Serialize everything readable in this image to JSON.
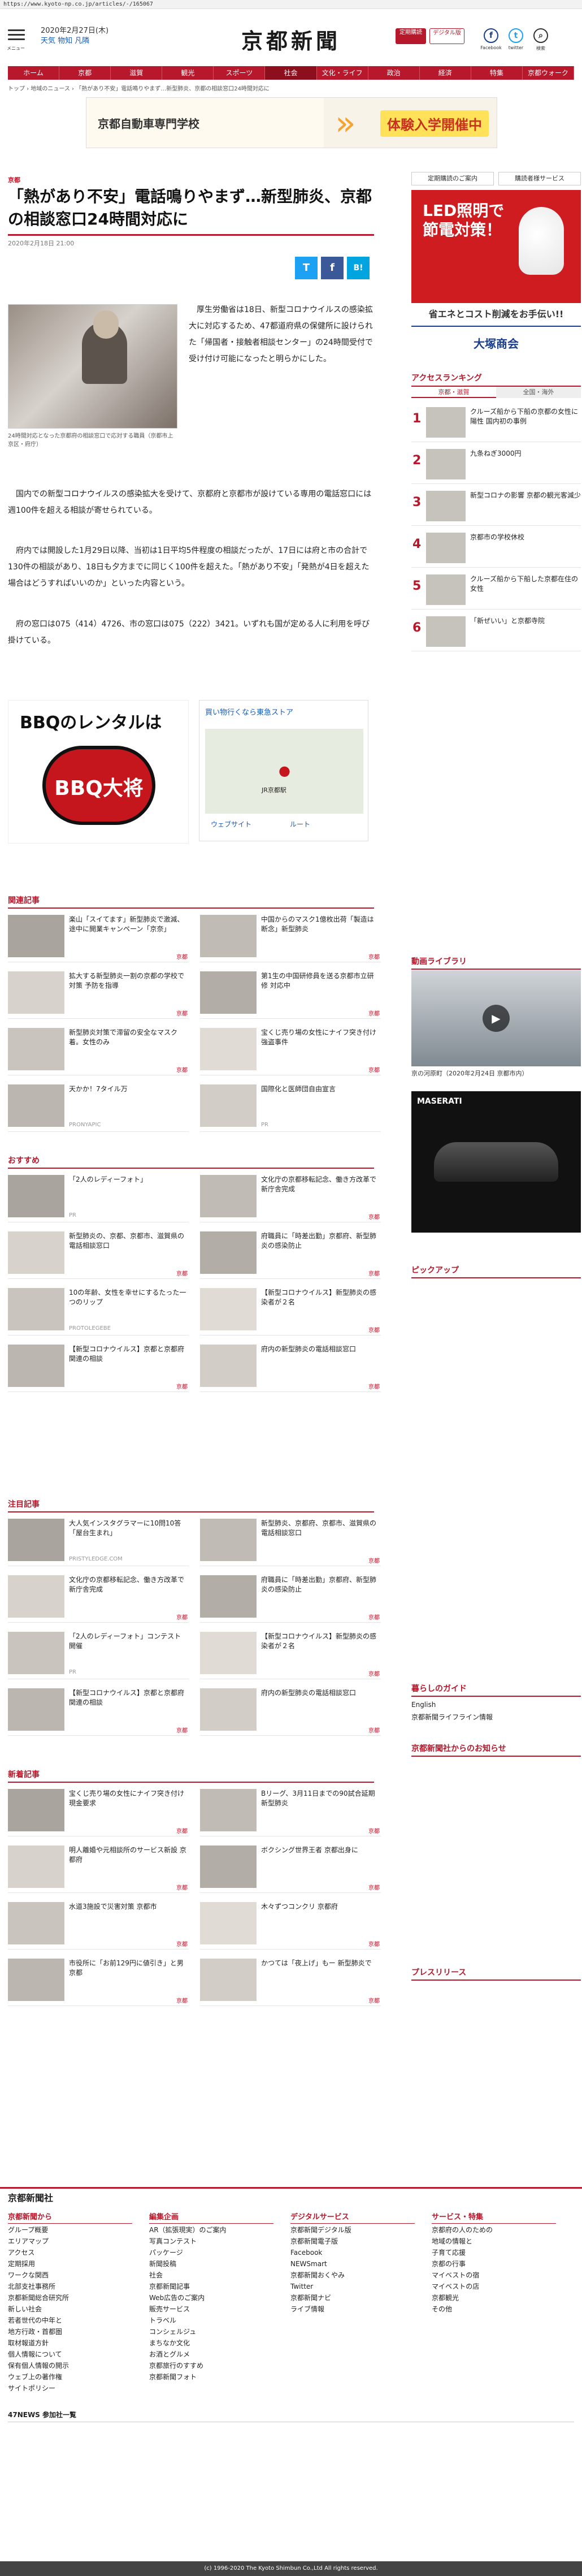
{
  "url": "https://www.kyoto-np.co.jp/articles/-/165067",
  "header": {
    "menu_label": "メニュー",
    "date": "2020年2月27日(木)",
    "weather": "天気 物知 凡隣",
    "logo": "京都新聞",
    "btn_subscribe": "定期購読",
    "btn_digital": "デジタル版",
    "icons": [
      "facebook-icon",
      "twitter-icon",
      "search-icon"
    ],
    "icon_labels": [
      "Facebook",
      "twitter",
      "検索"
    ]
  },
  "nav": [
    "ホーム",
    "京都",
    "滋賀",
    "観光",
    "スポーツ",
    "社会",
    "文化・ライフ",
    "政治",
    "経済",
    "特集",
    "京都ウォーク"
  ],
  "breadcrumb": "トップ › 地域のニュース › 「熱があり不安」電話鳴りやまず…新型肺炎、京都の相談窓口24時間対応に",
  "ad_top": {
    "left_text": "京都自動車専門学校",
    "right_text": "体験入学開催中"
  },
  "article": {
    "section": "京都",
    "headline": "「熱があり不安」電話鳴りやまず…新型肺炎、京都の相談窓口24時間対応に",
    "date": "2020年2月18日 21:00",
    "share": [
      "T",
      "f",
      "B!"
    ],
    "photo_caption": "24時間対応となった京都府の相談窓口で応対する職員（京都市上京区・府庁）",
    "paragraphs": [
      "厚生労働省は18日、新型コロナウイルスの感染拡大に対応するため、47都道府県の保健所に設けられた「帰国者・接触者相談センター」の24時間受付で受け付け可能になったと明らかにした。",
      "国内での新型コロナウイルスの感染拡大を受けて、京都府と京都市が設けている専用の電話窓口には週100件を超える相談が寄せられている。",
      "府内では開設した1月29日以降、当初は1日平均5件程度の相談だったが、17日には府と市の合計で130件の相談があり、18日も夕方までに同じく100件を超えた。「熱があり不安」「発熱が4日を超えた場合はどうすればいいのか」といった内容という。",
      "府の窓口は075（414）4726、市の窓口は075（222）3421。いずれも国が定める人に利用を呼び掛けている。"
    ]
  },
  "sidebar": {
    "links": [
      "定期購読のご案内",
      "購読者様サービス"
    ],
    "ad1": {
      "title": "LED照明で節電対策！",
      "mid": "省エネとコスト削減をお手伝い!!",
      "bot": "大塚商会"
    },
    "ranking_title": "アクセスランキング",
    "ranking_tabs": [
      "京都・滋賀",
      "全国・海外"
    ],
    "ranking": [
      {
        "num": "1",
        "text": "クルーズ船から下船の京都の女性に陽性 国内初の事例"
      },
      {
        "num": "2",
        "text": "九条ねぎ3000円"
      },
      {
        "num": "3",
        "text": "新型コロナの影響 京都の観光客減少"
      },
      {
        "num": "4",
        "text": "京都市の学校休校"
      },
      {
        "num": "5",
        "text": "クルーズ船から下船した京都在住の女性"
      },
      {
        "num": "6",
        "text": "「新ぜいい」と京都寺院"
      }
    ],
    "video_title": "動画ライブラリ",
    "video_caption": "京の河原町（2020年2月24日 京都市内）",
    "pickup_title": "ピックアップ",
    "guide_title": "暮らしのガイド",
    "guide_items": [
      "English",
      "京都新聞ライフライン情報"
    ],
    "notice_title": "京都新聞社からのお知らせ",
    "press_title": "プレスリリース"
  },
  "ad_bbq": {
    "title": "BBQのレンタルは",
    "logo": "BBQ大将"
  },
  "ad_map": {
    "title": "買い物行くなら東急ストア",
    "sub": "JR京都駅",
    "btns": [
      "ウェブサイト",
      "ルート"
    ]
  },
  "related": {
    "title": "関連記事",
    "items": [
      {
        "text": "楽山「スイてます」新型肺炎で激減、途中に開業キャンペーン「京奈」",
        "src": "京都"
      },
      {
        "text": "中国からのマスク1億枚出荷「製造は断念」新型肺炎",
        "src": "京都"
      },
      {
        "text": "拡大する新型肺炎一割の京都の学校で対策 予防を指導",
        "src": "京都"
      },
      {
        "text": "第1生の中国研修員を送る京都市立研修 対応中",
        "src": "京都"
      },
      {
        "text": "新型肺炎対策で滞留の安全なマスク着。女性のみ",
        "src": "京都"
      },
      {
        "text": "宝くじ売り場の女性にナイフ突き付け強盗事件",
        "src": "京都"
      },
      {
        "text": "天かか！7タイル万",
        "src": "PRONYAPIC"
      },
      {
        "text": "国際化と医師団自由宣言",
        "src": "PR"
      }
    ]
  },
  "recommend": {
    "title": "おすすめ",
    "items": [
      {
        "text": "「2人のレディーフォト」",
        "src": "PR"
      },
      {
        "text": "文化庁の京都移転記念、働き方改革で新庁舎完成",
        "src": "京都"
      },
      {
        "text": "新型肺炎の、京都、京都市、滋賀県の電話相談窓口",
        "src": "京都"
      },
      {
        "text": "府職員に「時差出勤」京都府、新型肺炎の感染防止",
        "src": "京都"
      },
      {
        "text": "10の年齢、女性を幸せにするたった一つのリップ",
        "src": "PROTOLEGEBE"
      },
      {
        "text": "【新型コロナウイルス】新型肺炎の感染者が２名",
        "src": "京都"
      },
      {
        "text": "【新型コロナウイルス】京都と京都府関連の相談",
        "src": "京都"
      },
      {
        "text": "府内の新型肺炎の電話相談窓口",
        "src": "京都"
      }
    ]
  },
  "notable": {
    "title": "注目記事",
    "items": [
      {
        "text": "大人気インスタグラマーに10問10答「屋台生まれ」",
        "src": "PRISTYLEDGE.COM"
      },
      {
        "text": "新型肺炎、京都府、京都市、滋賀県の電話相談窓口",
        "src": "京都"
      },
      {
        "text": "文化庁の京都移転記念、働き方改革で新庁舎完成",
        "src": "京都"
      },
      {
        "text": "府職員に「時差出勤」京都府、新型肺炎の感染防止",
        "src": "京都"
      },
      {
        "text": "「2人のレディーフォト」コンテスト開催",
        "src": "PR"
      },
      {
        "text": "【新型コロナウイルス】新型肺炎の感染者が２名",
        "src": "京都"
      },
      {
        "text": "【新型コロナウイルス】京都と京都府関連の相談",
        "src": "京都"
      },
      {
        "text": "府内の新型肺炎の電話相談窓口",
        "src": "京都"
      }
    ]
  },
  "newest": {
    "title": "新着記事",
    "items": [
      {
        "text": "宝くじ売り場の女性にナイフ突き付け現金要求",
        "src": "京都"
      },
      {
        "text": "Bリーグ、3月11日までの90試合延期 新型肺炎",
        "src": "京都"
      },
      {
        "text": "明人離婚や元相談所のサービス新設 京都府",
        "src": "京都"
      },
      {
        "text": "ボクシング世界王者 京都出身に",
        "src": "京都"
      },
      {
        "text": "水道3施設で災害対策 京都市",
        "src": "京都"
      },
      {
        "text": "木々ずつコンクリ 京都府",
        "src": "京都"
      },
      {
        "text": "市役所に「お前129円に値引き」と男 京都",
        "src": "京都"
      },
      {
        "text": "かつては「夜上げ」もー 新型肺炎で",
        "src": "京都"
      }
    ]
  },
  "footer": {
    "logo": "京都新聞社",
    "columns": [
      {
        "title": "京都新聞から",
        "items": [
          "グループ概要",
          "エリアマップ",
          "アクセス",
          "定期採用",
          "ワークな関西",
          "北部支社事務所",
          "京都新聞総合研究所",
          "新しい社会",
          "若者世代の中年と",
          "地方行政・首都圏",
          "取材報道方針",
          "個人情報について",
          "保有個人情報の開示",
          "ウェブ上の著作権",
          "サイトポリシー"
        ]
      },
      {
        "title": "編集企画",
        "items": [
          "AR（拡張現実）のご案内",
          "写真コンテスト",
          "パッケージ",
          "新聞投稿",
          "社会",
          "京都新聞記事",
          "Web広告のご案内",
          "販売サービス",
          "トラベル",
          "コンシェルジュ",
          "まちなか文化",
          "お酒とグルメ",
          "京都旅行のすすめ",
          "京都新聞フォト"
        ]
      },
      {
        "title": "デジタルサービス",
        "items": [
          "京都新聞デジタル版",
          "京都新聞電子版",
          "Facebook",
          "NEWSmart",
          "京都新聞おくやみ",
          "Twitter",
          "京都新聞ナビ",
          "ライブ情報"
        ]
      },
      {
        "title": "サービス・特集",
        "items": [
          "京都府の人のための",
          "地域の情報と",
          "子育て応援",
          "京都の行事",
          "マイベストの宿",
          "マイベストの店",
          "京都観光",
          "その他"
        ]
      }
    ],
    "bottom_title": "47NEWS 参加社一覧",
    "copyright": "(c) 1996-2020 The Kyoto Shimbun Co.,Ltd All rights reserved."
  }
}
